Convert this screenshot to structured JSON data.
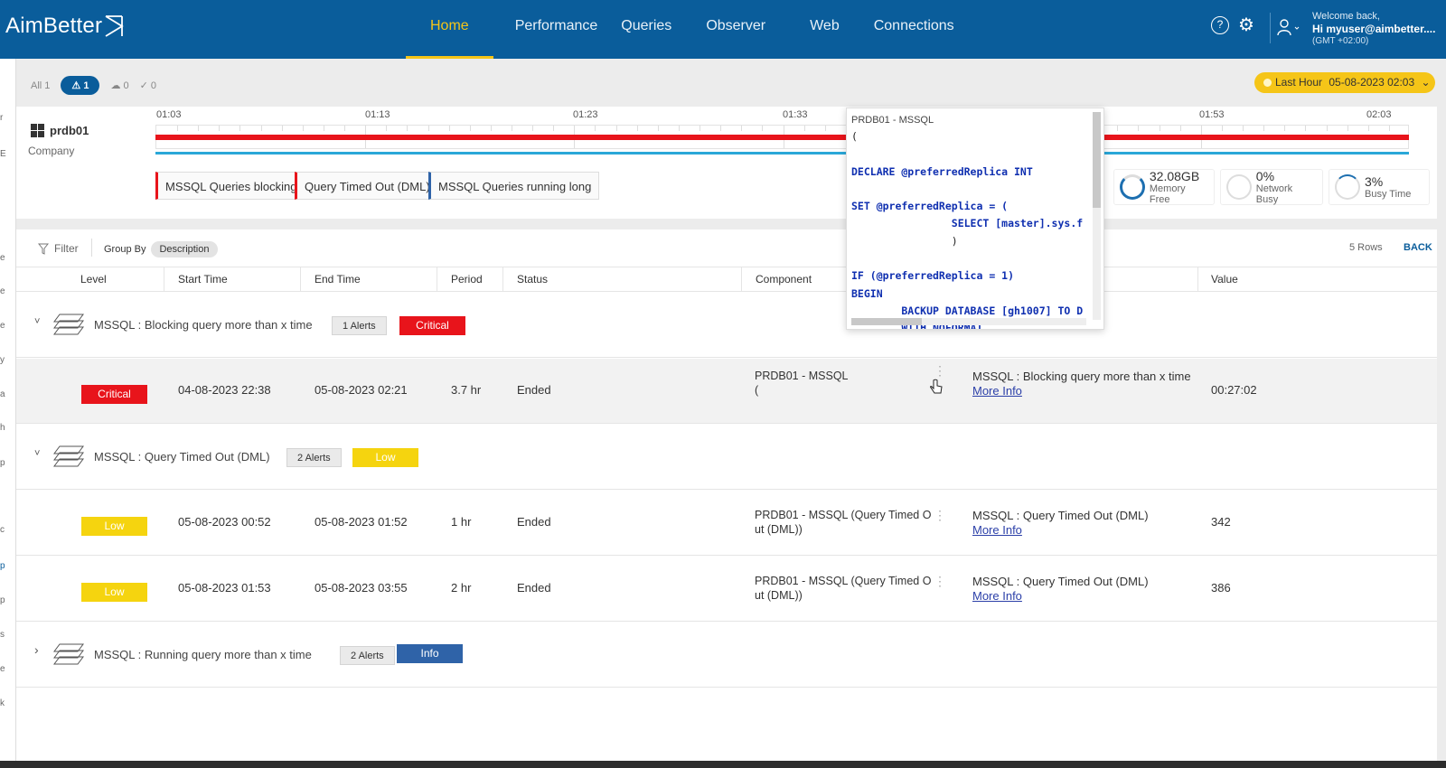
{
  "app": {
    "logo": "AimBetter"
  },
  "nav": [
    "Home",
    "Performance",
    "Queries",
    "Observer",
    "Web",
    "Connections"
  ],
  "user": {
    "welcome": "Welcome back,",
    "name": "Hi myuser@aimbetter....",
    "tz": "(GMT +02:00)"
  },
  "filters": {
    "all": "All 1",
    "alerts": "1",
    "cloud": "0",
    "check": "0"
  },
  "time_range": {
    "label": "Last Hour",
    "value": "05-08-2023 02:03"
  },
  "server": {
    "name": "prdb01",
    "company": "Company"
  },
  "timeline_ticks": [
    "01:03",
    "01:13",
    "01:23",
    "01:33",
    "01:53",
    "02:03"
  ],
  "tags": [
    "MSSQL Queries blocking",
    "Query Timed Out (DML)",
    "MSSQL Queries running long"
  ],
  "metrics": [
    {
      "value": "32.08GB",
      "label": "Memory Free"
    },
    {
      "value": "0%",
      "label": "Network Busy"
    },
    {
      "value": "3%",
      "label": "Busy Time"
    }
  ],
  "toolbar": {
    "filter": "Filter",
    "group_by": "Group By",
    "group_chip": "Description",
    "rows": "5 Rows",
    "back": "BACK"
  },
  "columns": [
    "Level",
    "Start Time",
    "End Time",
    "Period",
    "Status",
    "Component",
    "Value"
  ],
  "groups": [
    {
      "title": "MSSQL : Blocking query more than x time",
      "count": "1 Alerts",
      "severity": "Critical",
      "chevron": "˅"
    },
    {
      "title": "MSSQL : Query Timed Out (DML)",
      "count": "2 Alerts",
      "severity": "Low",
      "chevron": "˅"
    },
    {
      "title": "MSSQL : Running query more than x time",
      "count": "2 Alerts",
      "severity": "Info",
      "chevron": "›"
    }
  ],
  "rows": [
    {
      "level": "Critical",
      "start": "04-08-2023 22:38",
      "end": "05-08-2023 02:21",
      "period": "3.7 hr",
      "status": "Ended",
      "component_1": "PRDB01 - MSSQL",
      "component_2": "(",
      "desc": "MSSQL : Blocking query more than x time",
      "more": "More Info",
      "value": "00:27:02"
    },
    {
      "level": "Low",
      "start": "05-08-2023 00:52",
      "end": "05-08-2023 01:52",
      "period": "1 hr",
      "status": "Ended",
      "component_1": "PRDB01 - MSSQL (Query Timed O",
      "component_2": "ut (DML))",
      "desc": "MSSQL : Query Timed Out (DML)",
      "more": "More Info",
      "value": "342"
    },
    {
      "level": "Low",
      "start": "05-08-2023 01:53",
      "end": "05-08-2023 03:55",
      "period": "2 hr",
      "status": "Ended",
      "component_1": "PRDB01 - MSSQL (Query Timed O",
      "component_2": "ut (DML))",
      "desc": "MSSQL : Query Timed Out (DML)",
      "more": "More Info",
      "value": "386"
    }
  ],
  "popup": {
    "header": "PRDB01 - MSSQL",
    "lines": [
      "(",
      "",
      "DECLARE @preferredReplica INT",
      "",
      "SET @preferredReplica = (",
      "                SELECT [master].sys.f",
      "                )",
      "",
      "IF (@preferredReplica = 1)",
      "BEGIN",
      "        BACKUP DATABASE [gh1007] TO D",
      "        WITH NOFORMAT"
    ]
  },
  "colors": {
    "nav_bg": "#0a5d9b",
    "active": "#f5c518",
    "critical": "#e8141b",
    "low": "#f5d40f",
    "info": "#2f63a8"
  }
}
